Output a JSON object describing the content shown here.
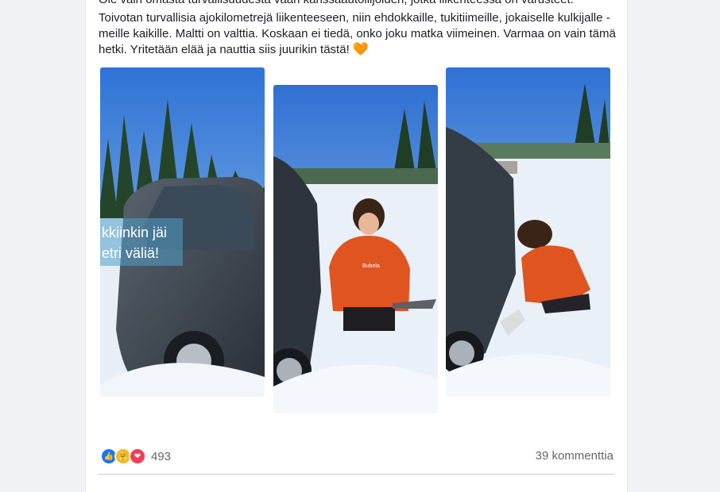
{
  "post": {
    "cut_text": "Ole vain omasta turvallisuudesta vaan kanssaautoilijoiden, jotka liikenteessä on varusteet.",
    "paragraph": "Toivotan turvallisia ajokilometrejä liikenteeseen, niin ehdokkaille, tukitiimeille, jokaiselle kulkijalle - meille kaikille. Maltti on valttia. Koskaan ei tiedä, onko joku matka viimeinen. Varmaa on vain tämä hetki. Yritetään elää ja nauttia siis juurikin tästä!",
    "emoji": "🧡"
  },
  "photos": {
    "overlay_line1": "kkiinkin jäi",
    "overlay_line2": "etri väliä!",
    "jacket_logo": "Bubela"
  },
  "reactions": {
    "icons": [
      "like-icon",
      "care-icon",
      "love-icon"
    ],
    "count": "493"
  },
  "comments": {
    "label": "39 kommenttia"
  },
  "colors": {
    "like": "#1877f2",
    "care": "#f7b928",
    "love": "#f33e58",
    "text_secondary": "#65676b",
    "jacket": "#e0541f"
  }
}
